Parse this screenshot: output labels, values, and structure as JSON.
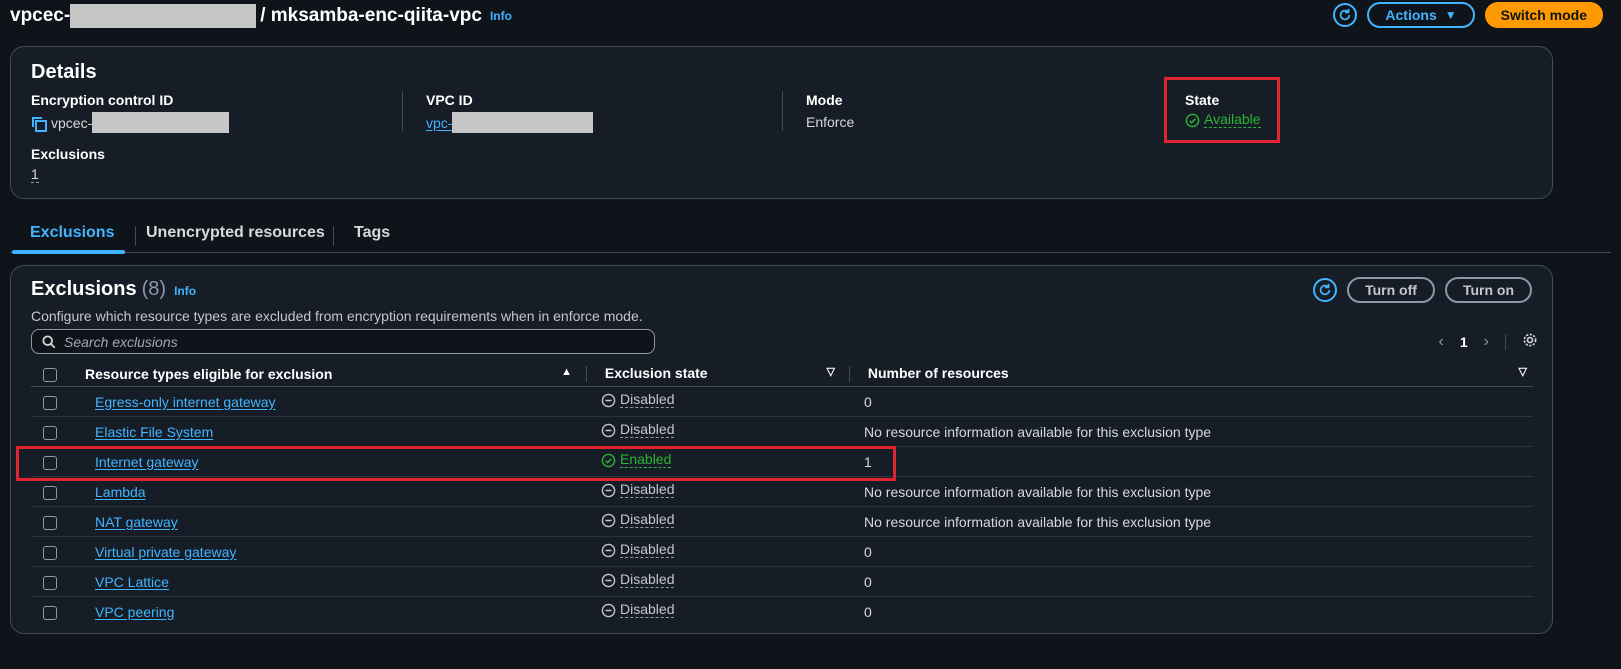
{
  "header": {
    "title_prefix": "vpcec-",
    "title_suffix": "/ mksamba-enc-qiita-vpc",
    "info": "Info",
    "actions_label": "Actions",
    "switch_mode_label": "Switch mode"
  },
  "details": {
    "heading": "Details",
    "encryption_control_id_label": "Encryption control ID",
    "encryption_control_id_value": "vpcec-",
    "vpc_id_label": "VPC ID",
    "vpc_id_value": "vpc-",
    "mode_label": "Mode",
    "mode_value": "Enforce",
    "state_label": "State",
    "state_value": "Available",
    "exclusions_label": "Exclusions",
    "exclusions_value": "1"
  },
  "tabs": [
    "Exclusions",
    "Unencrypted resources",
    "Tags"
  ],
  "exclusions": {
    "heading": "Exclusions",
    "count": "(8)",
    "info": "Info",
    "description": "Configure which resource types are excluded from encryption requirements when in enforce mode.",
    "turn_off_label": "Turn off",
    "turn_on_label": "Turn on",
    "search_placeholder": "Search exclusions",
    "page": "1",
    "columns": [
      "Resource types eligible for exclusion",
      "Exclusion state",
      "Number of resources"
    ],
    "rows": [
      {
        "name": "Egress-only internet gateway",
        "state": "Disabled",
        "resources": "0"
      },
      {
        "name": "Elastic File System",
        "state": "Disabled",
        "resources": "No resource information available for this exclusion type"
      },
      {
        "name": "Internet gateway",
        "state": "Enabled",
        "resources": "1"
      },
      {
        "name": "Lambda",
        "state": "Disabled",
        "resources": "No resource information available for this exclusion type"
      },
      {
        "name": "NAT gateway",
        "state": "Disabled",
        "resources": "No resource information available for this exclusion type"
      },
      {
        "name": "Virtual private gateway",
        "state": "Disabled",
        "resources": "0"
      },
      {
        "name": "VPC Lattice",
        "state": "Disabled",
        "resources": "0"
      },
      {
        "name": "VPC peering",
        "state": "Disabled",
        "resources": "0"
      }
    ]
  },
  "colors": {
    "accent": "#42b4ff",
    "primary": "#ff9900",
    "success": "#2bb534",
    "highlight": "#e0232e"
  }
}
